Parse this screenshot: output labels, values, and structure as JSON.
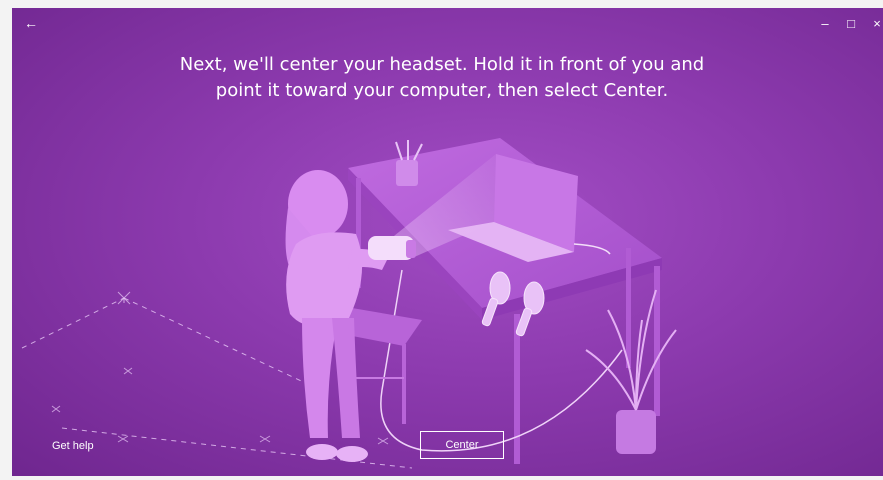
{
  "titlebar": {
    "back_icon": "←",
    "minimize_icon": "–",
    "maximize_icon": "□",
    "close_icon": "×"
  },
  "main": {
    "instruction": "Next, we'll center your headset. Hold it in front of you and point it toward your computer, then select Center."
  },
  "footer": {
    "help_label": "Get help",
    "center_label": "Center"
  },
  "colors": {
    "background": "#8c3aae",
    "accent": "#ffffff"
  }
}
